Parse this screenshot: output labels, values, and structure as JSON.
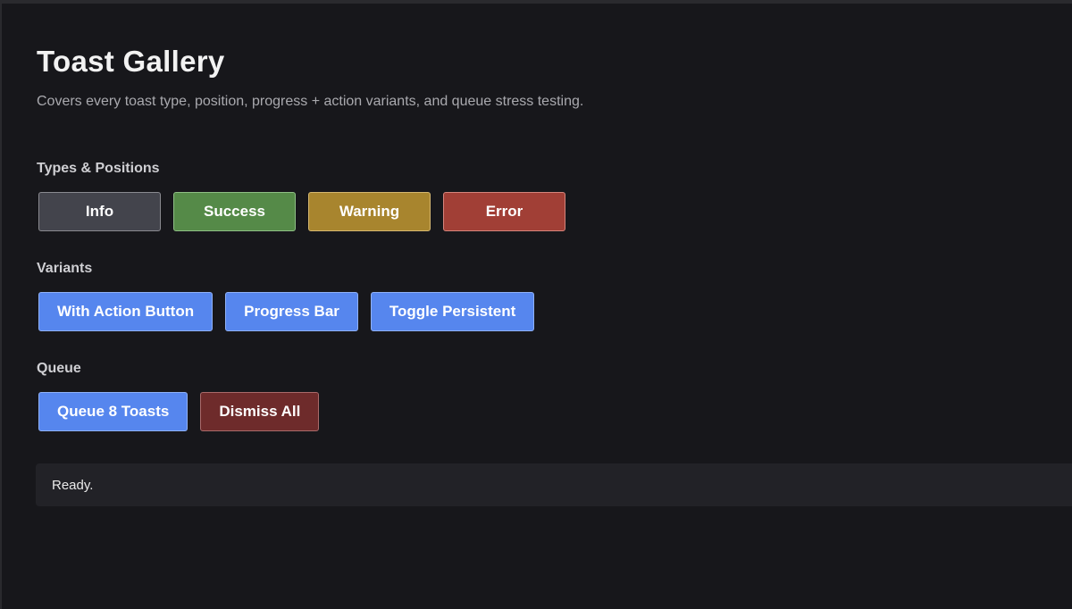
{
  "page": {
    "title": "Toast Gallery",
    "subtitle": "Covers every toast type, position, progress + action variants, and queue stress testing."
  },
  "sections": {
    "types": {
      "label": "Types & Positions",
      "buttons": [
        "Info",
        "Success",
        "Warning",
        "Error"
      ]
    },
    "variants": {
      "label": "Variants",
      "buttons": [
        "With Action Button",
        "Progress Bar",
        "Toggle Persistent"
      ]
    },
    "queue": {
      "label": "Queue",
      "buttons": [
        "Queue 8 Toasts",
        "Dismiss All"
      ]
    }
  },
  "status": {
    "text": "Ready."
  },
  "colors": {
    "background": "#17171b",
    "info": "#43444c",
    "success": "#558a48",
    "warning": "#a8852e",
    "error": "#a13f36",
    "primary": "#5686ee",
    "danger": "#6e2b2b"
  }
}
